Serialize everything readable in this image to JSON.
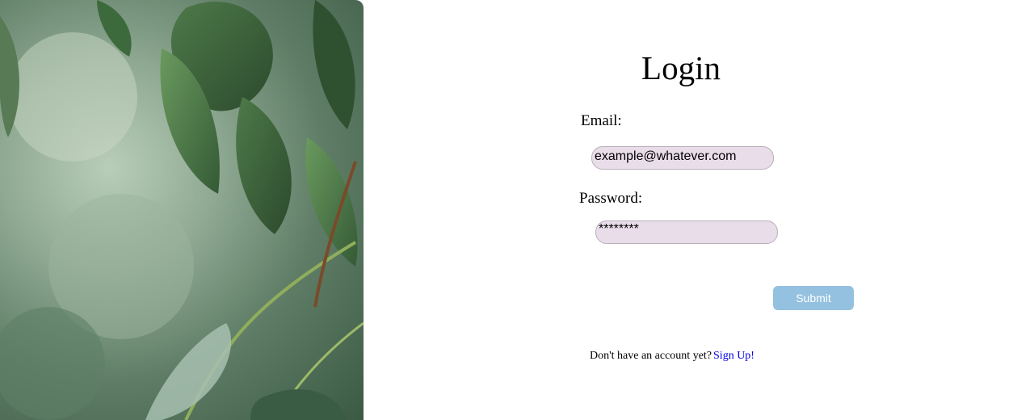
{
  "login": {
    "title": "Login",
    "email_label": "Email:",
    "email_value": "example@whatever.com",
    "password_label": "Password:",
    "password_value": "********",
    "submit_label": "Submit",
    "signup_prompt": "Don't have an account yet?",
    "signup_link": "Sign Up!"
  },
  "colors": {
    "input_bg": "#e8dde8",
    "submit_bg": "#94c1df",
    "link": "#0000ee"
  }
}
